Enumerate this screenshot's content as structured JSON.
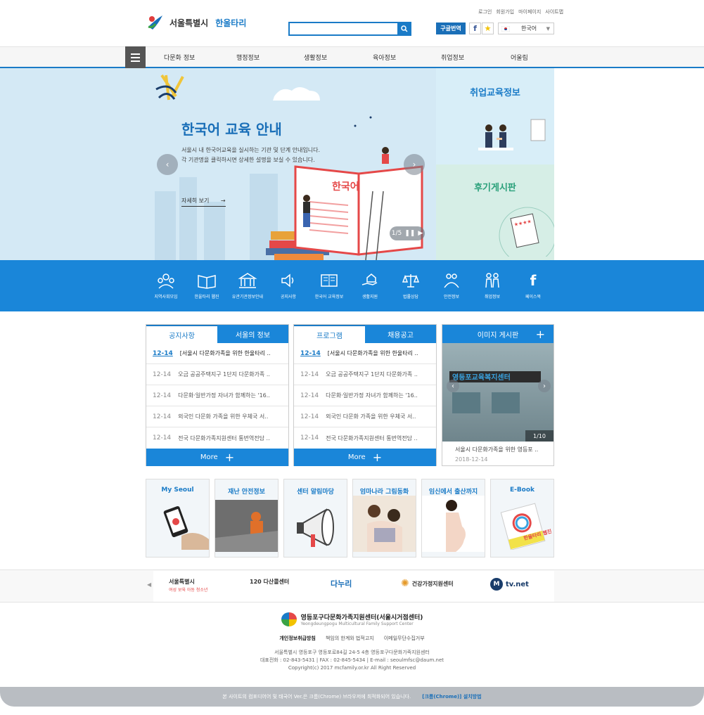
{
  "header": {
    "logo_city": "서울특별시",
    "logo_site": "한울타리",
    "util_links": [
      "로그인",
      "회원가입",
      "마이페이지",
      "사이트맵"
    ],
    "google_translate": "구글번역",
    "facebook": "f",
    "language": "한국어"
  },
  "nav": {
    "items": [
      "다문화 정보",
      "행정정보",
      "생활정보",
      "육아정보",
      "취업정보",
      "어울림"
    ]
  },
  "hero": {
    "title": "한국어 교육 안내",
    "desc_line1": "서울시 내 한국어교육을 실시하는 기관 및 단계 안내입니다.",
    "desc_line2": "각 기관명을 클릭하시면 상세한 설명을 보실 수 있습니다.",
    "more": "자세히 보기",
    "book_text": "한국어",
    "pager": "1/5",
    "side1_title": "취업교육정보",
    "side2_title": "후기게시판"
  },
  "icons": [
    "지역사회모임",
    "한울타리 웹진",
    "유관기관정보안내",
    "공지사항",
    "한국어 교육정보",
    "생활지원",
    "법률상담",
    "안전정보",
    "취업정보",
    "페이스북"
  ],
  "board1": {
    "tab_on": "공지사항",
    "tab_off": "서울의 정보",
    "rows": [
      {
        "date": "12-14",
        "subject": "[서울시 다문화가족을 위한 한울타리 .."
      },
      {
        "date": "12-14",
        "subject": "오금 공공주택지구 1단지 다문화가족 .."
      },
      {
        "date": "12-14",
        "subject": "다문화·일반가정 자녀가 함께하는 '16.."
      },
      {
        "date": "12-14",
        "subject": "외국인 다문화 가족을 위한 우체국 서.."
      },
      {
        "date": "12-14",
        "subject": "전국 다문화가족지원센터 통번역전담 .."
      }
    ],
    "more": "More"
  },
  "board2": {
    "tab_on": "프로그램",
    "tab_off": "채용공고",
    "rows": [
      {
        "date": "12-14",
        "subject": "[서울시 다문화가족을 위한 한울타리 .."
      },
      {
        "date": "12-14",
        "subject": "오금 공공주택지구 1단지 다문화가족 .."
      },
      {
        "date": "12-14",
        "subject": "다문화·일반가정 자녀가 함께하는 '16.."
      },
      {
        "date": "12-14",
        "subject": "외국인 다문화 가족을 위한 우체국 서.."
      },
      {
        "date": "12-14",
        "subject": "전국 다문화가족지원센터 통번역전담 .."
      }
    ],
    "more": "More"
  },
  "image_board": {
    "title": "이미지 게시판",
    "photo_sign": "영등포교육복지센터",
    "counter": "1/10",
    "caption": "서울시 다문화가족을 위한 영등포 ..",
    "date": "2018-12-14"
  },
  "banners": [
    "My Seoul",
    "재난 안전정보",
    "센터 알림마당",
    "엄마나라 그림동화",
    "임신에서 출산까지",
    "E-Book"
  ],
  "ebook_cover": "한울타리 웹진",
  "partners": [
    {
      "name": "서울특별시",
      "sub": "여성 보육 아동 청소년"
    },
    {
      "name": "120 다산콜센터",
      "sub": ""
    },
    {
      "name": "다누리",
      "sub": ""
    },
    {
      "name": "건강가정지원센터",
      "sub": ""
    },
    {
      "name": "tv.net",
      "sub": ""
    }
  ],
  "footer": {
    "org_name": "영등포구다문화가족지원센터(서울시거점센터)",
    "org_en": "Yeongdeungpogu Multicultural Family Support Center",
    "links": [
      "개인정보취급방침",
      "책임의 한계와 법적고지",
      "이메일무단수집거부"
    ],
    "address": "서울특별시 영등포구 영등포로84길 24-5 4층 영등포구다문화가족지원센터",
    "contact": "대표전화 : 02-843-5431   |   FAX : 02-845-5434   |   E-mail : seoulmfsc@daum.net",
    "copyright": "Copyright(c) 2017 mcfamily.or.kr All Right Reserved",
    "notice": "본 사이트의 컴포디어어 및 태국어 Ver.은 크롬(Chrome) 브라우저에 최적화되어 있습니다.",
    "notice_link": "[크롬(Chrome)] 설치방법"
  },
  "colors": {
    "primary": "#1a86d9",
    "dark_blue": "#1a6fb8"
  }
}
